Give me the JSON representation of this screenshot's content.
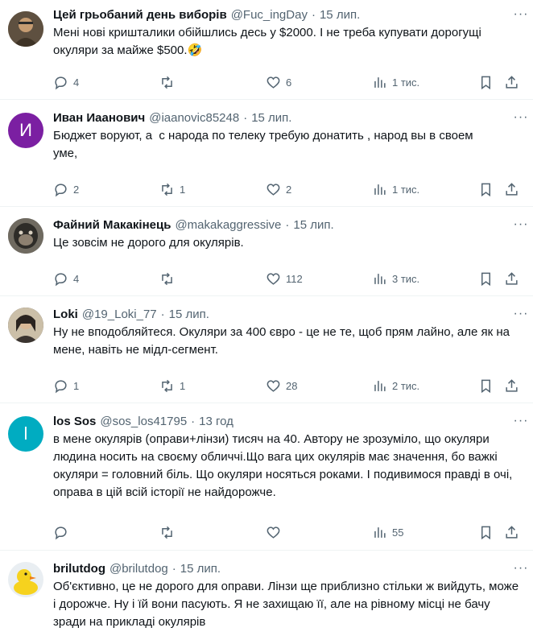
{
  "tweets": [
    {
      "name": "Цей грьобаний день виборів",
      "handle": "@Fuc_ingDay",
      "sep": "·",
      "time": "15 лип.",
      "text": "Мені нові кришталики обійшлись десь у $2000. І не треба купувати дорогущі окуляри за майже $500.🤣",
      "replies": "4",
      "retweets": "",
      "likes": "6",
      "views": "1 тис.",
      "avatar": {
        "type": "photo",
        "colors": [
          "#6b5a3e",
          "#c49a6c"
        ],
        "icon": "person-photo"
      }
    },
    {
      "name": "Иван Иаанович",
      "handle": "@iaanovic85248",
      "sep": "·",
      "time": "15 лип.",
      "text": "Бюджет воруют, а  с народа по телеку требую донатить , народ вы в своем уме,",
      "replies": "2",
      "retweets": "1",
      "likes": "2",
      "views": "1 тис.",
      "avatar": {
        "type": "letter",
        "letter": "И",
        "color": "#7b1fa2"
      }
    },
    {
      "name": "Файний Макакінець",
      "handle": "@makakaggressive",
      "sep": "·",
      "time": "15 лип.",
      "text": "Це зовсім не дорого для окулярів.",
      "replies": "4",
      "retweets": "",
      "likes": "112",
      "views": "3 тис.",
      "avatar": {
        "type": "photo",
        "colors": [
          "#3a3a3a",
          "#8a8478"
        ],
        "icon": "monkey-photo"
      }
    },
    {
      "name": "Loki",
      "handle": "@19_Loki_77",
      "sep": "·",
      "time": "15 лип.",
      "text": "Ну не вподобляйтеся. Окуляри за 400 євро - це не те, щоб прям лайно, але як на мене, навіть не мідл-сегмент.",
      "replies": "1",
      "retweets": "1",
      "likes": "28",
      "views": "2 тис.",
      "avatar": {
        "type": "photo",
        "colors": [
          "#2b2b2b",
          "#b8a48a"
        ],
        "icon": "person-photo"
      }
    },
    {
      "name": "los Sos",
      "handle": "@sos_los41795",
      "sep": "·",
      "time": "13 год",
      "text": "в мене окулярів (оправи+лінзи) тисяч на 40. Автору не зрозуміло, що окуляри людина носить на своєму обличчі.Що вага цих окулярів має значення, бо важкі окуляри = головний біль. Що окуляри носяться роками. І подивимося правді в очі, оправа в цій всій історії не найдорожче.",
      "replies": "",
      "retweets": "",
      "likes": "",
      "views": "55",
      "avatar": {
        "type": "letter",
        "letter": "l",
        "color": "#00acc1"
      }
    },
    {
      "name": "brilutdog",
      "handle": "@brilutdog",
      "sep": "·",
      "time": "15 лип.",
      "text": "Об'єктивно, це не дорого для оправи. Лінзи ще приблизно стільки ж вийдуть, може і дорожче. Ну і їй вони пасують. Я не захищаю її, але на рівному місці не бачу зради на прикладі окулярів",
      "replies": "",
      "retweets": "",
      "likes": "",
      "views": "",
      "avatar": {
        "type": "photo",
        "colors": [
          "#f6d21e",
          "#e8a317"
        ],
        "icon": "duck-photo"
      }
    }
  ],
  "more_label": "···"
}
